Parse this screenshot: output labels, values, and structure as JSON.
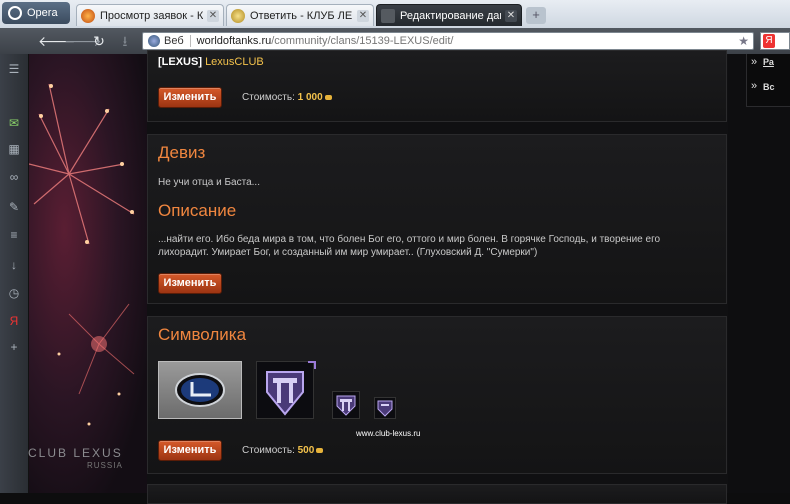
{
  "browser": {
    "menu_label": "Opera",
    "tabs": [
      {
        "title": "Просмотр заявок - К..."
      },
      {
        "title": "Ответить - КЛУБ ЛЕК..."
      },
      {
        "title": "Редактирование данн..."
      }
    ],
    "address": {
      "badge": "Веб",
      "host": "worldoftanks.ru",
      "path": "/community/clans/15139-LEXUS/edit/"
    }
  },
  "clan_name": {
    "tag": "[LEXUS]",
    "name": "LexusCLUB",
    "button": "Изменить",
    "cost_label": "Стоимость:",
    "cost_value": "1 000"
  },
  "motto": {
    "heading": "Девиз",
    "text": "Не учи отца и Баста..."
  },
  "description": {
    "heading": "Описание",
    "text": "...найти его. Ибо беда мира в том, что болен Бог его, оттого и мир болен. В горячке Господь, и творение его лихорадит. Умирает Бог, и созданный им мир умирает.. (Глуховский Д. \"Сумерки\")",
    "button": "Изменить"
  },
  "symbolics": {
    "heading": "Символика",
    "button": "Изменить",
    "cost_label": "Стоимость:",
    "cost_value": "500"
  },
  "right_panel": {
    "items": [
      "Ра",
      "Вс"
    ]
  },
  "watermark": {
    "title": "CLUB LEXUS",
    "sub": "RUSSIA",
    "url": "www.club-lexus.ru"
  },
  "colors": {
    "accent": "#f0863f",
    "button": "#c04a1d",
    "gold": "#f3c24c"
  }
}
